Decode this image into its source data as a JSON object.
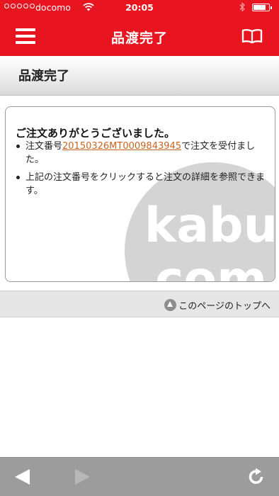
{
  "status_bar": {
    "carrier": "docomo",
    "time": "20:05",
    "battery_level": 0.8
  },
  "nav": {
    "title": "品渡完了",
    "menu_icon": "hamburger-menu-icon",
    "right_icon": "book-icon"
  },
  "page": {
    "heading": "品渡完了"
  },
  "message": {
    "title": "ご注文ありがとうございました。",
    "line1_prefix": "注文番号",
    "order_number": "20150326MT0009843945",
    "line1_suffix": "で注文を受付ました。",
    "line2": "上記の注文番号をクリックすると注文の詳細を参照できます。",
    "watermark_text": [
      "kabu",
      "com"
    ]
  },
  "footer": {
    "page_top_label": "このページのトップへ"
  },
  "toolbar": {
    "back_icon": "back-arrow-icon",
    "forward_icon": "forward-arrow-icon",
    "reload_icon": "reload-icon"
  },
  "colors": {
    "brand_red": "#e8141f",
    "link_orange": "#c8641e",
    "toolbar_gray": "#9c9c9c"
  }
}
